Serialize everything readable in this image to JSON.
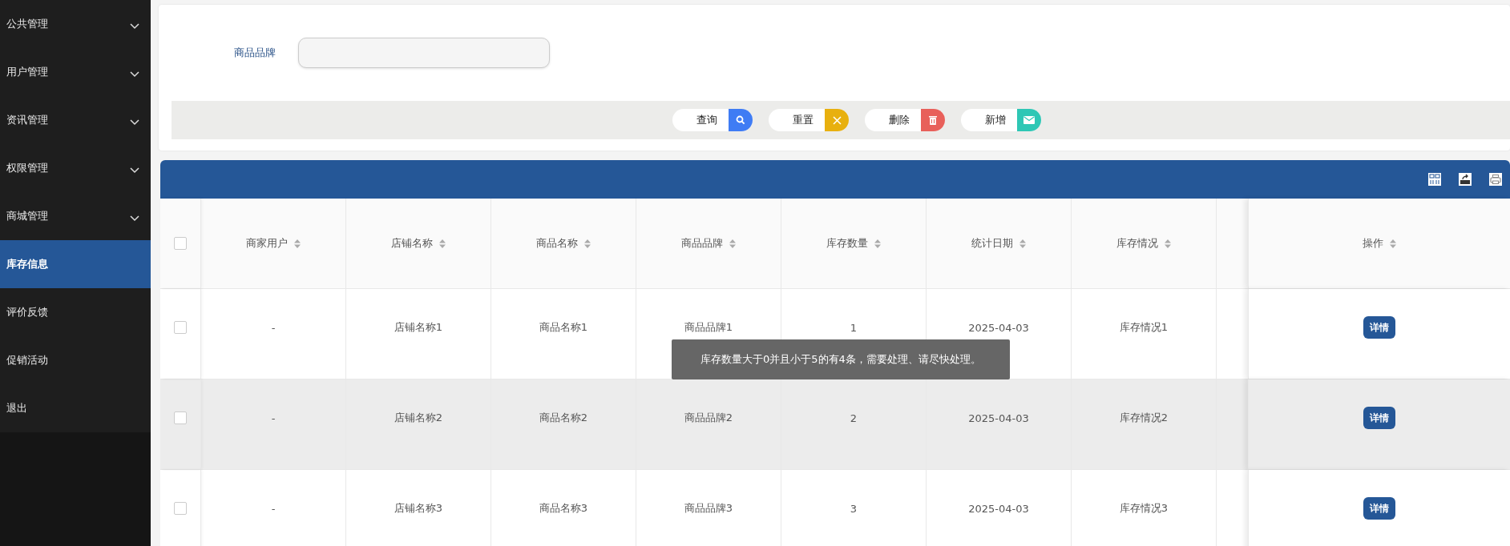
{
  "sidebar": {
    "items": [
      {
        "label": "公共管理",
        "expandable": true,
        "selected": false
      },
      {
        "label": "用户管理",
        "expandable": true,
        "selected": false
      },
      {
        "label": "资讯管理",
        "expandable": true,
        "selected": false
      },
      {
        "label": "权限管理",
        "expandable": true,
        "selected": false
      },
      {
        "label": "商城管理",
        "expandable": true,
        "selected": false
      },
      {
        "label": "库存信息",
        "expandable": false,
        "selected": true
      },
      {
        "label": "评价反馈",
        "expandable": false,
        "selected": false
      },
      {
        "label": "促销活动",
        "expandable": false,
        "selected": false
      },
      {
        "label": "退出",
        "expandable": false,
        "selected": false
      }
    ]
  },
  "search": {
    "label": "商品品牌"
  },
  "buttons": [
    {
      "label": "查询",
      "kind": "search",
      "color": "#3f7cf4"
    },
    {
      "label": "重置",
      "kind": "reset",
      "color": "#e8b00f"
    },
    {
      "label": "删除",
      "kind": "delete",
      "color": "#e8605a"
    },
    {
      "label": "新增",
      "kind": "add",
      "color": "#2ec7b5"
    }
  ],
  "table": {
    "header_checked": false,
    "columns": [
      "商家用户",
      "店铺名称",
      "商品名称",
      "商品品牌",
      "库存数量",
      "统计日期",
      "库存情况"
    ],
    "action_column": "操作",
    "rows": [
      {
        "checked": false,
        "highlighted": false,
        "cells": [
          "-",
          "店铺名称1",
          "商品名称1",
          "商品品牌1",
          "1",
          "2025-04-03",
          "库存情况1"
        ],
        "action": "详情"
      },
      {
        "checked": false,
        "highlighted": true,
        "cells": [
          "-",
          "店铺名称2",
          "商品名称2",
          "商品品牌2",
          "2",
          "2025-04-03",
          "库存情况2"
        ],
        "action": "详情"
      },
      {
        "checked": false,
        "highlighted": false,
        "cells": [
          "-",
          "店铺名称3",
          "商品名称3",
          "商品品牌3",
          "3",
          "2025-04-03",
          "库存情况3"
        ],
        "action": "详情"
      }
    ]
  },
  "toast": {
    "message": "库存数量大于0并且小于5的有4条，需要处理、请尽快处理。"
  }
}
